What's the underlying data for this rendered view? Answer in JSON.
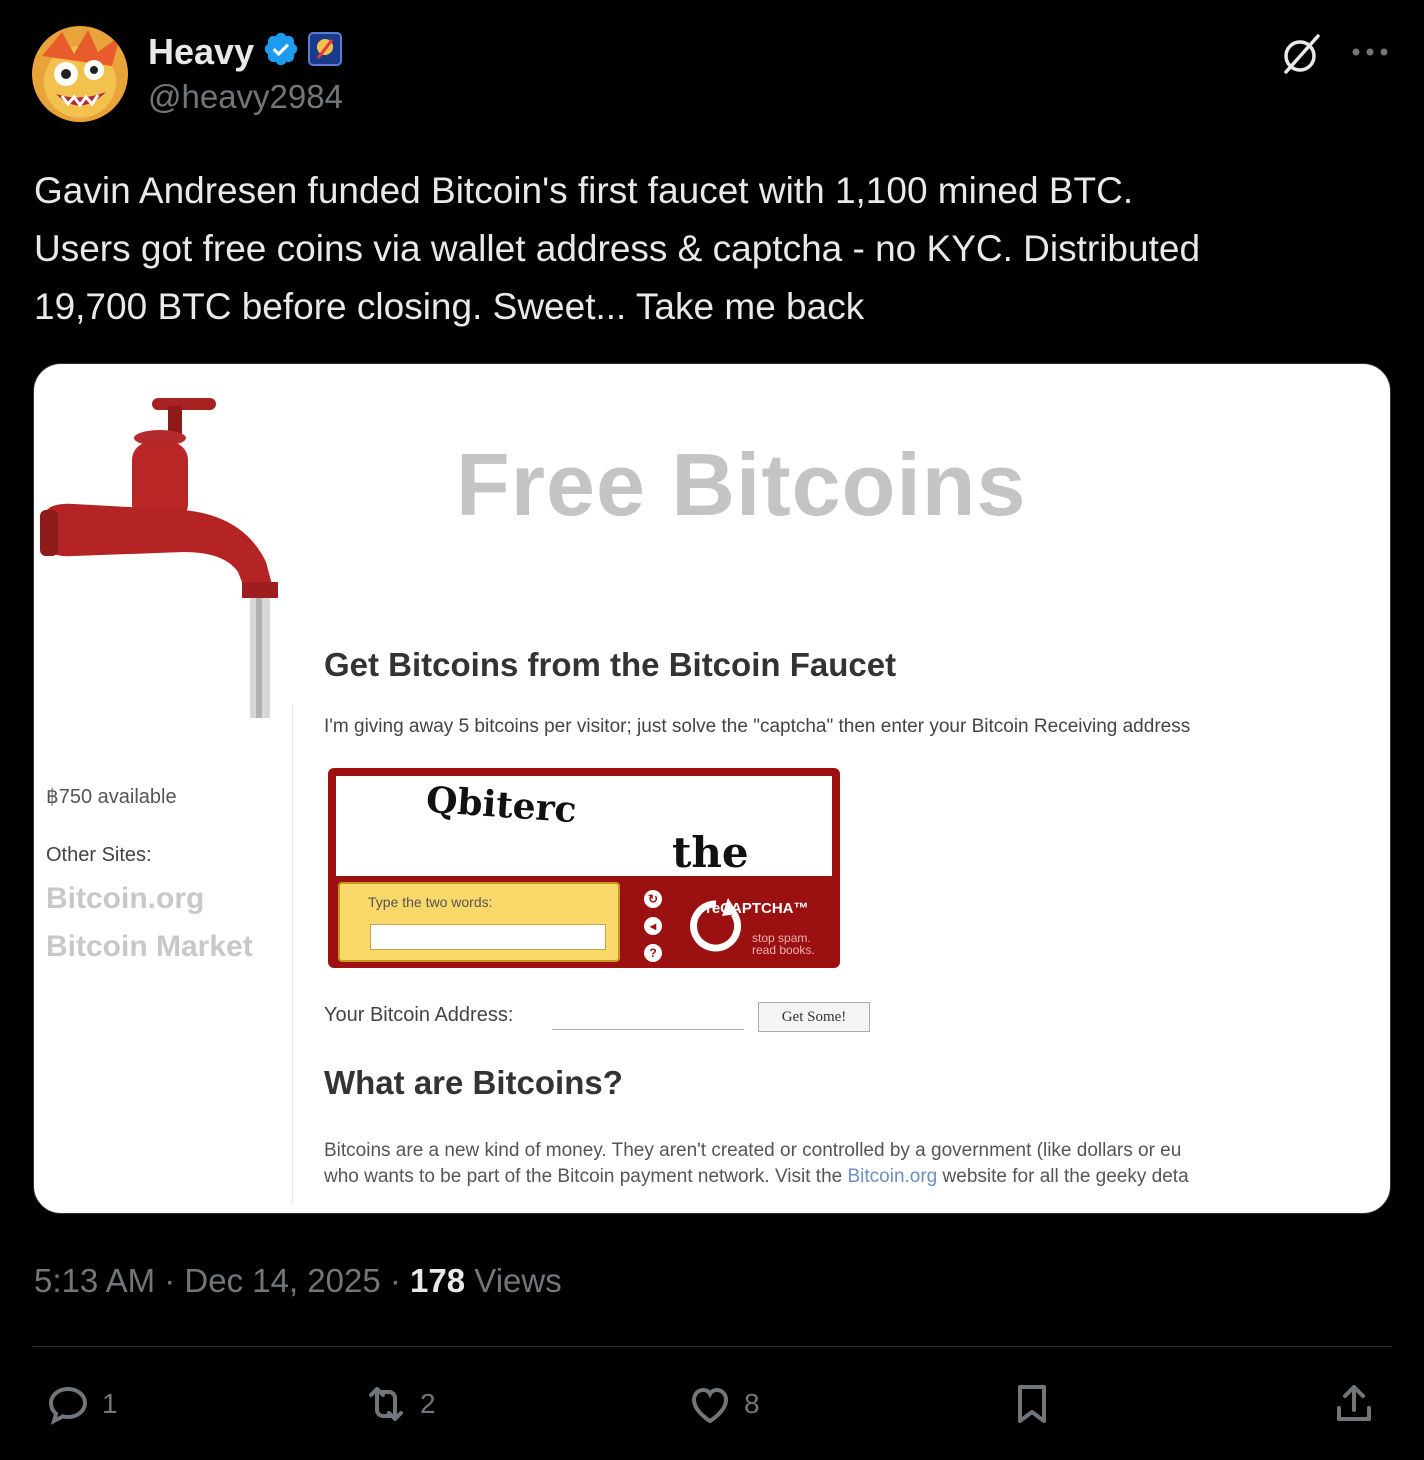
{
  "author": {
    "display_name": "Heavy",
    "handle": "@heavy2984"
  },
  "icons": {
    "verified": "verified-badge-icon",
    "affiliate": "affiliate-badge-icon",
    "grok": "grok-icon",
    "more": "more-icon",
    "reply": "reply-icon",
    "retweet": "retweet-icon",
    "like": "like-icon",
    "bookmark": "bookmark-icon",
    "share": "share-icon"
  },
  "colors": {
    "background": "#000000",
    "text": "#e7e9ea",
    "muted": "#71767b",
    "verified": "#1d9bf0",
    "divider": "#2f3336"
  },
  "tweet": {
    "text": "Gavin Andresen funded Bitcoin's first faucet with 1,100 mined BTC.\nUsers got free coins via wallet address & captcha - no KYC. Distributed\n19,700 BTC before closing. Sweet... Take me back"
  },
  "embedded_image": {
    "title": "Free Bitcoins",
    "available": "฿750 available",
    "other_sites_label": "Other Sites:",
    "other_sites": [
      "Bitcoin.org",
      "Bitcoin Market"
    ],
    "heading": "Get Bitcoins from the Bitcoin Faucet",
    "intro": "I'm giving away 5 bitcoins per visitor; just solve the \"captcha\" then enter your Bitcoin Receiving address",
    "captcha": {
      "word1": "Qbiterc",
      "word2": "the",
      "prompt": "Type the two words:",
      "logo": "reCAPTCHA™",
      "tagline1": "stop spam.",
      "tagline2": "read books."
    },
    "address_label": "Your Bitcoin Address:",
    "button": "Get Some!",
    "what_heading": "What are Bitcoins?",
    "body1": "Bitcoins are a new kind of money. They aren't created or controlled by a government (like dollars or eu",
    "body2_pre": "who wants to be part of the Bitcoin payment network. Visit the ",
    "body2_link": "Bitcoin.org",
    "body2_post": " website for all the geeky deta"
  },
  "meta": {
    "time": "5:13 AM",
    "separator": " · ",
    "date": "Dec 14, 2025",
    "views_count": "178",
    "views_label": " Views"
  },
  "actions": {
    "replies": "1",
    "retweets": "2",
    "likes": "8"
  }
}
